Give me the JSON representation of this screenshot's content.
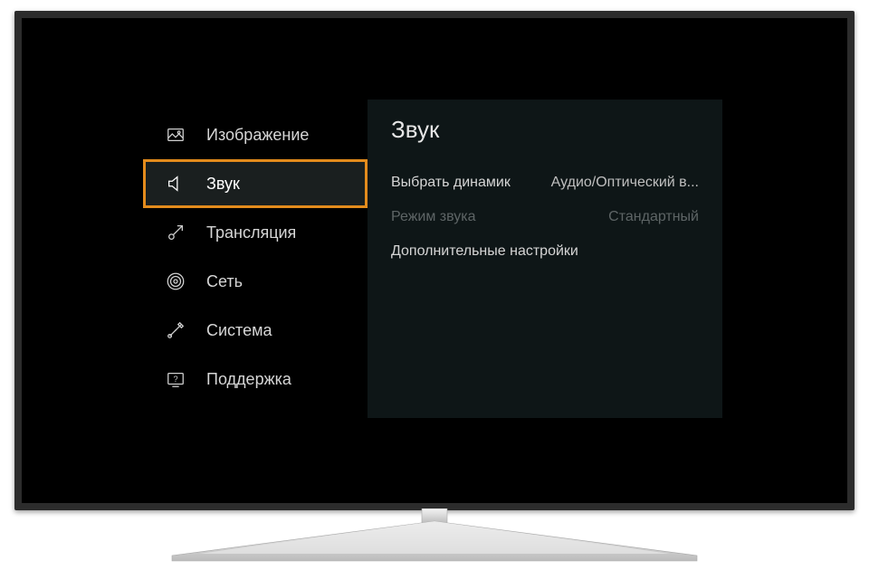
{
  "sidebar": {
    "items": [
      {
        "label": "Изображение",
        "icon": "image-icon"
      },
      {
        "label": "Звук",
        "icon": "speaker-icon",
        "selected": true
      },
      {
        "label": "Трансляция",
        "icon": "antenna-icon"
      },
      {
        "label": "Сеть",
        "icon": "network-icon"
      },
      {
        "label": "Система",
        "icon": "tools-icon"
      },
      {
        "label": "Поддержка",
        "icon": "support-icon"
      }
    ]
  },
  "content": {
    "title": "Звук",
    "rows": [
      {
        "label": "Выбрать динамик",
        "value": "Аудио/Оптический в...",
        "disabled": false
      },
      {
        "label": "Режим звука",
        "value": "Стандартный",
        "disabled": true
      },
      {
        "label": "Дополнительные настройки",
        "value": "",
        "disabled": false
      }
    ]
  },
  "colors": {
    "highlight_border": "#e38b1c",
    "panel_bg": "#0e1617"
  }
}
